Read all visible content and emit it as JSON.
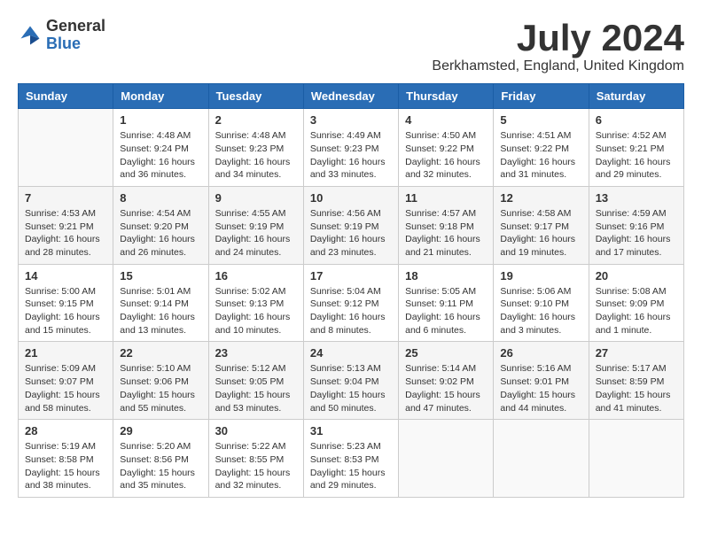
{
  "header": {
    "logo_general": "General",
    "logo_blue": "Blue",
    "month_title": "July 2024",
    "location": "Berkhamsted, England, United Kingdom"
  },
  "days_of_week": [
    "Sunday",
    "Monday",
    "Tuesday",
    "Wednesday",
    "Thursday",
    "Friday",
    "Saturday"
  ],
  "weeks": [
    {
      "stripe": "light",
      "days": [
        {
          "number": "",
          "info": ""
        },
        {
          "number": "1",
          "info": "Sunrise: 4:48 AM\nSunset: 9:24 PM\nDaylight: 16 hours\nand 36 minutes."
        },
        {
          "number": "2",
          "info": "Sunrise: 4:48 AM\nSunset: 9:23 PM\nDaylight: 16 hours\nand 34 minutes."
        },
        {
          "number": "3",
          "info": "Sunrise: 4:49 AM\nSunset: 9:23 PM\nDaylight: 16 hours\nand 33 minutes."
        },
        {
          "number": "4",
          "info": "Sunrise: 4:50 AM\nSunset: 9:22 PM\nDaylight: 16 hours\nand 32 minutes."
        },
        {
          "number": "5",
          "info": "Sunrise: 4:51 AM\nSunset: 9:22 PM\nDaylight: 16 hours\nand 31 minutes."
        },
        {
          "number": "6",
          "info": "Sunrise: 4:52 AM\nSunset: 9:21 PM\nDaylight: 16 hours\nand 29 minutes."
        }
      ]
    },
    {
      "stripe": "alt",
      "days": [
        {
          "number": "7",
          "info": "Sunrise: 4:53 AM\nSunset: 9:21 PM\nDaylight: 16 hours\nand 28 minutes."
        },
        {
          "number": "8",
          "info": "Sunrise: 4:54 AM\nSunset: 9:20 PM\nDaylight: 16 hours\nand 26 minutes."
        },
        {
          "number": "9",
          "info": "Sunrise: 4:55 AM\nSunset: 9:19 PM\nDaylight: 16 hours\nand 24 minutes."
        },
        {
          "number": "10",
          "info": "Sunrise: 4:56 AM\nSunset: 9:19 PM\nDaylight: 16 hours\nand 23 minutes."
        },
        {
          "number": "11",
          "info": "Sunrise: 4:57 AM\nSunset: 9:18 PM\nDaylight: 16 hours\nand 21 minutes."
        },
        {
          "number": "12",
          "info": "Sunrise: 4:58 AM\nSunset: 9:17 PM\nDaylight: 16 hours\nand 19 minutes."
        },
        {
          "number": "13",
          "info": "Sunrise: 4:59 AM\nSunset: 9:16 PM\nDaylight: 16 hours\nand 17 minutes."
        }
      ]
    },
    {
      "stripe": "light",
      "days": [
        {
          "number": "14",
          "info": "Sunrise: 5:00 AM\nSunset: 9:15 PM\nDaylight: 16 hours\nand 15 minutes."
        },
        {
          "number": "15",
          "info": "Sunrise: 5:01 AM\nSunset: 9:14 PM\nDaylight: 16 hours\nand 13 minutes."
        },
        {
          "number": "16",
          "info": "Sunrise: 5:02 AM\nSunset: 9:13 PM\nDaylight: 16 hours\nand 10 minutes."
        },
        {
          "number": "17",
          "info": "Sunrise: 5:04 AM\nSunset: 9:12 PM\nDaylight: 16 hours\nand 8 minutes."
        },
        {
          "number": "18",
          "info": "Sunrise: 5:05 AM\nSunset: 9:11 PM\nDaylight: 16 hours\nand 6 minutes."
        },
        {
          "number": "19",
          "info": "Sunrise: 5:06 AM\nSunset: 9:10 PM\nDaylight: 16 hours\nand 3 minutes."
        },
        {
          "number": "20",
          "info": "Sunrise: 5:08 AM\nSunset: 9:09 PM\nDaylight: 16 hours\nand 1 minute."
        }
      ]
    },
    {
      "stripe": "alt",
      "days": [
        {
          "number": "21",
          "info": "Sunrise: 5:09 AM\nSunset: 9:07 PM\nDaylight: 15 hours\nand 58 minutes."
        },
        {
          "number": "22",
          "info": "Sunrise: 5:10 AM\nSunset: 9:06 PM\nDaylight: 15 hours\nand 55 minutes."
        },
        {
          "number": "23",
          "info": "Sunrise: 5:12 AM\nSunset: 9:05 PM\nDaylight: 15 hours\nand 53 minutes."
        },
        {
          "number": "24",
          "info": "Sunrise: 5:13 AM\nSunset: 9:04 PM\nDaylight: 15 hours\nand 50 minutes."
        },
        {
          "number": "25",
          "info": "Sunrise: 5:14 AM\nSunset: 9:02 PM\nDaylight: 15 hours\nand 47 minutes."
        },
        {
          "number": "26",
          "info": "Sunrise: 5:16 AM\nSunset: 9:01 PM\nDaylight: 15 hours\nand 44 minutes."
        },
        {
          "number": "27",
          "info": "Sunrise: 5:17 AM\nSunset: 8:59 PM\nDaylight: 15 hours\nand 41 minutes."
        }
      ]
    },
    {
      "stripe": "light",
      "days": [
        {
          "number": "28",
          "info": "Sunrise: 5:19 AM\nSunset: 8:58 PM\nDaylight: 15 hours\nand 38 minutes."
        },
        {
          "number": "29",
          "info": "Sunrise: 5:20 AM\nSunset: 8:56 PM\nDaylight: 15 hours\nand 35 minutes."
        },
        {
          "number": "30",
          "info": "Sunrise: 5:22 AM\nSunset: 8:55 PM\nDaylight: 15 hours\nand 32 minutes."
        },
        {
          "number": "31",
          "info": "Sunrise: 5:23 AM\nSunset: 8:53 PM\nDaylight: 15 hours\nand 29 minutes."
        },
        {
          "number": "",
          "info": ""
        },
        {
          "number": "",
          "info": ""
        },
        {
          "number": "",
          "info": ""
        }
      ]
    }
  ]
}
